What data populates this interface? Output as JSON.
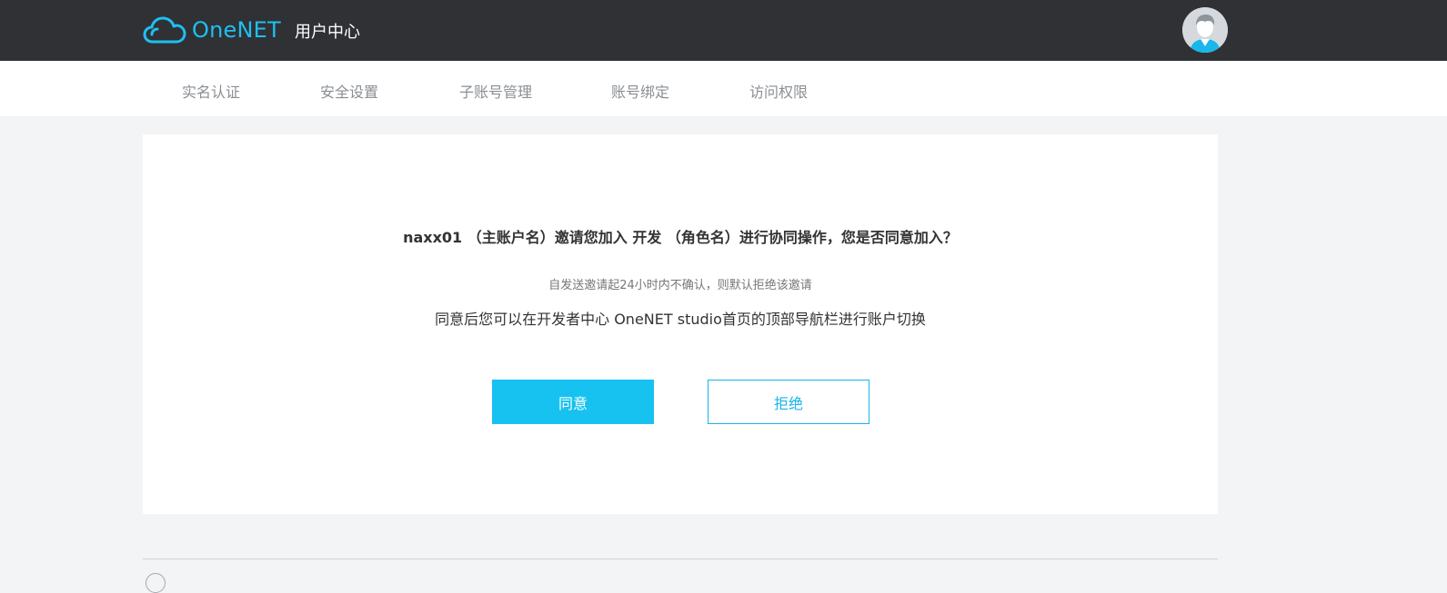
{
  "header": {
    "logo_text": "OneNET",
    "title": "用户中心",
    "avatar_icon": "user-avatar-icon",
    "brand_color": "#1ec0f0"
  },
  "nav": {
    "items": [
      {
        "label": "实名认证"
      },
      {
        "label": "安全设置"
      },
      {
        "label": "子账号管理"
      },
      {
        "label": "账号绑定"
      },
      {
        "label": "访问权限"
      }
    ]
  },
  "invite": {
    "question": "naxx01 （主账户名）邀请您加入 开发 （角色名）进行协同操作，您是否同意加入？",
    "hint": "自发送邀请起24小时内不确认，则默认拒绝该邀请",
    "description": "同意后您可以在开发者中心 OneNET studio首页的顶部导航栏进行账户切换",
    "agree_label": "同意",
    "reject_label": "拒绝",
    "accent_color": "#17c1f0"
  },
  "footer": {
    "icon": "circle-icon"
  }
}
